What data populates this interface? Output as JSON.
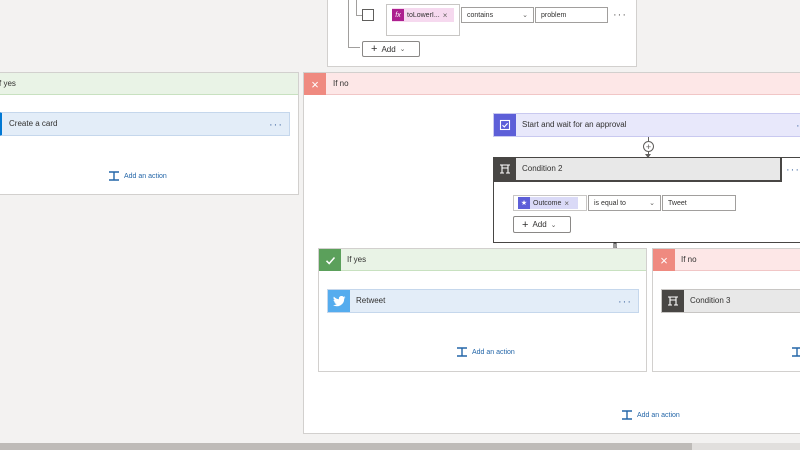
{
  "top_condition": {
    "token_label": "toLowerI...",
    "token_remove": "×",
    "operator": "contains",
    "value": "problem",
    "more": "···",
    "add_label": "Add"
  },
  "left_branch": {
    "header": "f yes",
    "card_title": "Create a card",
    "card_more": "···",
    "add_action": "Add an action"
  },
  "right_branch": {
    "header": "If no",
    "approval_title": "Start and wait for an approval",
    "approval_more": "···",
    "condition2": {
      "title": "Condition 2",
      "more": "···",
      "token_label": "Outcome",
      "token_remove": "×",
      "operator": "is equal to",
      "value": "Tweet",
      "add_label": "Add"
    },
    "inner_yes": {
      "header": "If yes",
      "card_title": "Retweet",
      "card_more": "···",
      "add_action": "Add an action"
    },
    "inner_no": {
      "header": "If no",
      "card_title": "Condition 3"
    },
    "add_action": "Add an action"
  },
  "colors": {
    "accent_blue": "#2466a8",
    "yes_green": "#5ba05b",
    "no_red": "#ef8a80",
    "approval_purple": "#5d5fd8",
    "twitter_blue": "#55acee",
    "condition_dark": "#484644",
    "expression_magenta": "#ad1f8f"
  },
  "icons": {
    "checkbox": "checkbox-icon",
    "fx": "function-icon",
    "approval": "approval-icon",
    "condition": "condition-icon",
    "twitter": "twitter-icon",
    "add_action": "add-action-icon",
    "check": "check-icon",
    "close": "close-icon",
    "plus": "plus-icon"
  }
}
